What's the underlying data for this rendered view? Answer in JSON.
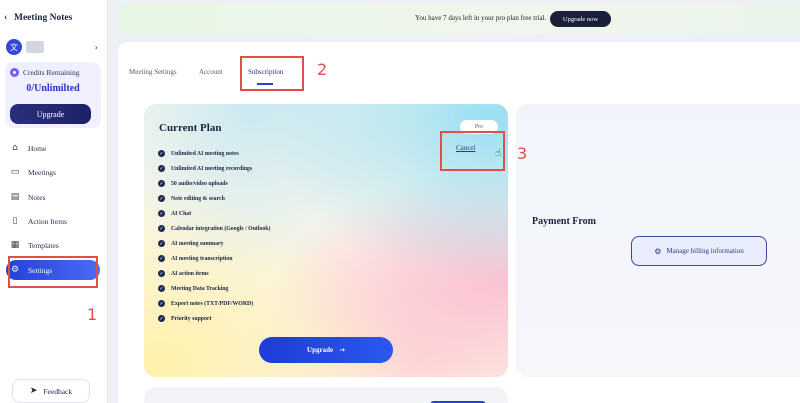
{
  "sidebar": {
    "title": "Meeting Notes",
    "user": {
      "avatar_text": "文",
      "chevron": "›"
    },
    "credits": {
      "label": "Credits Remaining",
      "value": "0/Unlimilted"
    },
    "upgrade_label": "Upgrade",
    "nav": [
      {
        "label": "Home",
        "icon": "home-icon"
      },
      {
        "label": "Meetings",
        "icon": "meetings-icon"
      },
      {
        "label": "Notes",
        "icon": "notes-icon"
      },
      {
        "label": "Action Items",
        "icon": "clipboard-icon"
      },
      {
        "label": "Templates",
        "icon": "templates-icon"
      },
      {
        "label": "Settings",
        "icon": "gear-icon",
        "active": true
      }
    ],
    "feedback_label": "Feedback"
  },
  "banner": {
    "text": "You have 7 days left in your pro plan free trial.",
    "button": "Upgrade now"
  },
  "tabs": [
    {
      "label": "Meeting Settings"
    },
    {
      "label": "Account"
    },
    {
      "label": "Subscription",
      "active": true
    }
  ],
  "plan": {
    "title": "Current Plan",
    "tier": "Pro",
    "cancel": "Cancel",
    "features": [
      "Unlimited AI meeting notes",
      "Unlimited AI meeting recordings",
      "50 audio/video uploads",
      "Note editing & search",
      "AI Chat",
      "Calendar integration (Google / Outlook)",
      "AI meeting summary",
      "AI meeting transcription",
      "AI action items",
      "Meeting Data Tracking",
      "Export notes (TXT/PDF/WORD)",
      "Priority support"
    ],
    "upgrade": "Upgrade",
    "upgrade_arrow": "→"
  },
  "payment": {
    "title": "Payment From",
    "manage": "Manage billing information"
  },
  "annotations": {
    "one": "1",
    "two": "2",
    "three": "3",
    "color": "#e0504a"
  },
  "colors": {
    "accent": "#2540d8",
    "dark": "#1b1f3a"
  }
}
